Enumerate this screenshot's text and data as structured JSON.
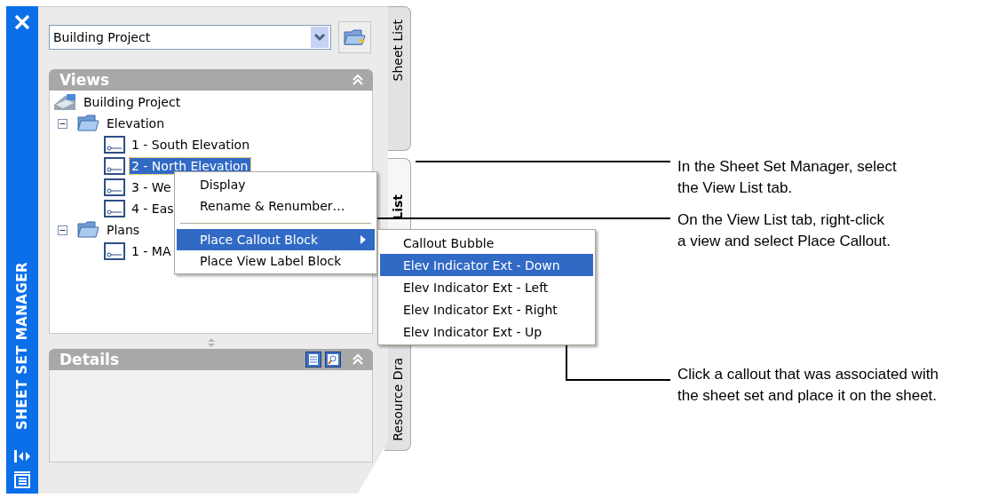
{
  "side_bar": {
    "title": "SHEET SET MANAGER"
  },
  "sheet_set_select": {
    "value": "Building Project"
  },
  "views": {
    "title": "Views",
    "tree": [
      {
        "label": "Building Project",
        "kind": "root",
        "selected": false,
        "children": [
          {
            "label": "Elevation",
            "kind": "folder",
            "expanded": true,
            "selected": false,
            "children": [
              {
                "label": "1 - South Elevation",
                "kind": "view",
                "selected": false
              },
              {
                "label": "2 - North Elevation",
                "kind": "view",
                "selected": true
              },
              {
                "label": "3 - We",
                "kind": "view",
                "selected": false
              },
              {
                "label": "4 - Eas",
                "kind": "view",
                "selected": false
              }
            ]
          },
          {
            "label": "Plans",
            "kind": "folder",
            "expanded": true,
            "selected": false,
            "children": [
              {
                "label": "1 - MA",
                "kind": "view",
                "selected": false
              }
            ]
          }
        ]
      }
    ]
  },
  "details": {
    "title": "Details"
  },
  "tabs": [
    {
      "label": "Sheet List",
      "selected": false
    },
    {
      "label": "List",
      "selected": true
    },
    {
      "label": "Resource Dra",
      "selected": false
    }
  ],
  "context_menu": {
    "items": [
      {
        "label": "Display",
        "kind": "item",
        "selected": false
      },
      {
        "label": "Rename & Renumber…",
        "kind": "item",
        "selected": false
      },
      {
        "kind": "separator"
      },
      {
        "label": "Place Callout Block",
        "kind": "submenu",
        "selected": true
      },
      {
        "label": "Place View Label Block",
        "kind": "item",
        "selected": false
      }
    ]
  },
  "submenu": {
    "items": [
      {
        "label": "Callout Bubble",
        "selected": false
      },
      {
        "label": "Elev Indicator Ext - Down",
        "selected": true
      },
      {
        "label": "Elev Indicator Ext - Left",
        "selected": false
      },
      {
        "label": "Elev Indicator Ext - Right",
        "selected": false
      },
      {
        "label": "Elev Indicator Ext - Up",
        "selected": false
      }
    ]
  },
  "annotations": [
    {
      "lines": [
        "In the Sheet Set Manager, select",
        "the View List tab."
      ]
    },
    {
      "lines": [
        "On the View List tab, right-click",
        "a view and select Place Callout."
      ]
    },
    {
      "lines": [
        "Click a callout that was associated with",
        "the sheet set and place it on the sheet."
      ]
    }
  ]
}
